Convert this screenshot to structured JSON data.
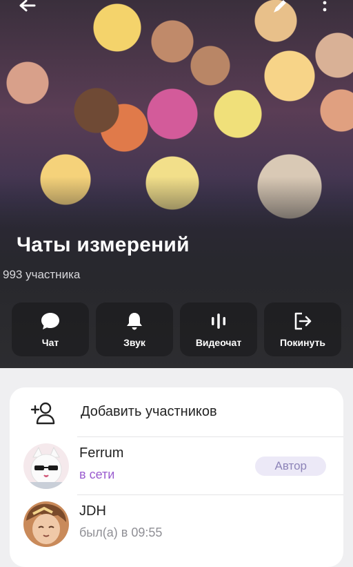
{
  "header": {
    "title": "Чаты измерений",
    "members_count": "993 участника",
    "icons": [
      "arrow-left-icon",
      "pencil-icon",
      "more-vertical-icon"
    ]
  },
  "actions": [
    {
      "label": "Чат",
      "icon": "chat-bubble-icon"
    },
    {
      "label": "Звук",
      "icon": "bell-icon"
    },
    {
      "label": "Видеочат",
      "icon": "sound-wave-icon"
    },
    {
      "label": "Покинуть",
      "icon": "exit-door-icon"
    }
  ],
  "members_list": {
    "add_label": "Добавить участников",
    "add_icon": "add-user-icon",
    "members": [
      {
        "name": "Ferrum",
        "status": "в сети",
        "badge": "Автор"
      },
      {
        "name": "JDH",
        "status": "был(а) в 09:55"
      }
    ]
  },
  "colors": {
    "accent": "#9a5ccf",
    "status_online": "#9a5ccf",
    "status_offline": "#8f8f95",
    "badge_bg": "#ece9f7",
    "badge_text": "#8d84b8"
  }
}
